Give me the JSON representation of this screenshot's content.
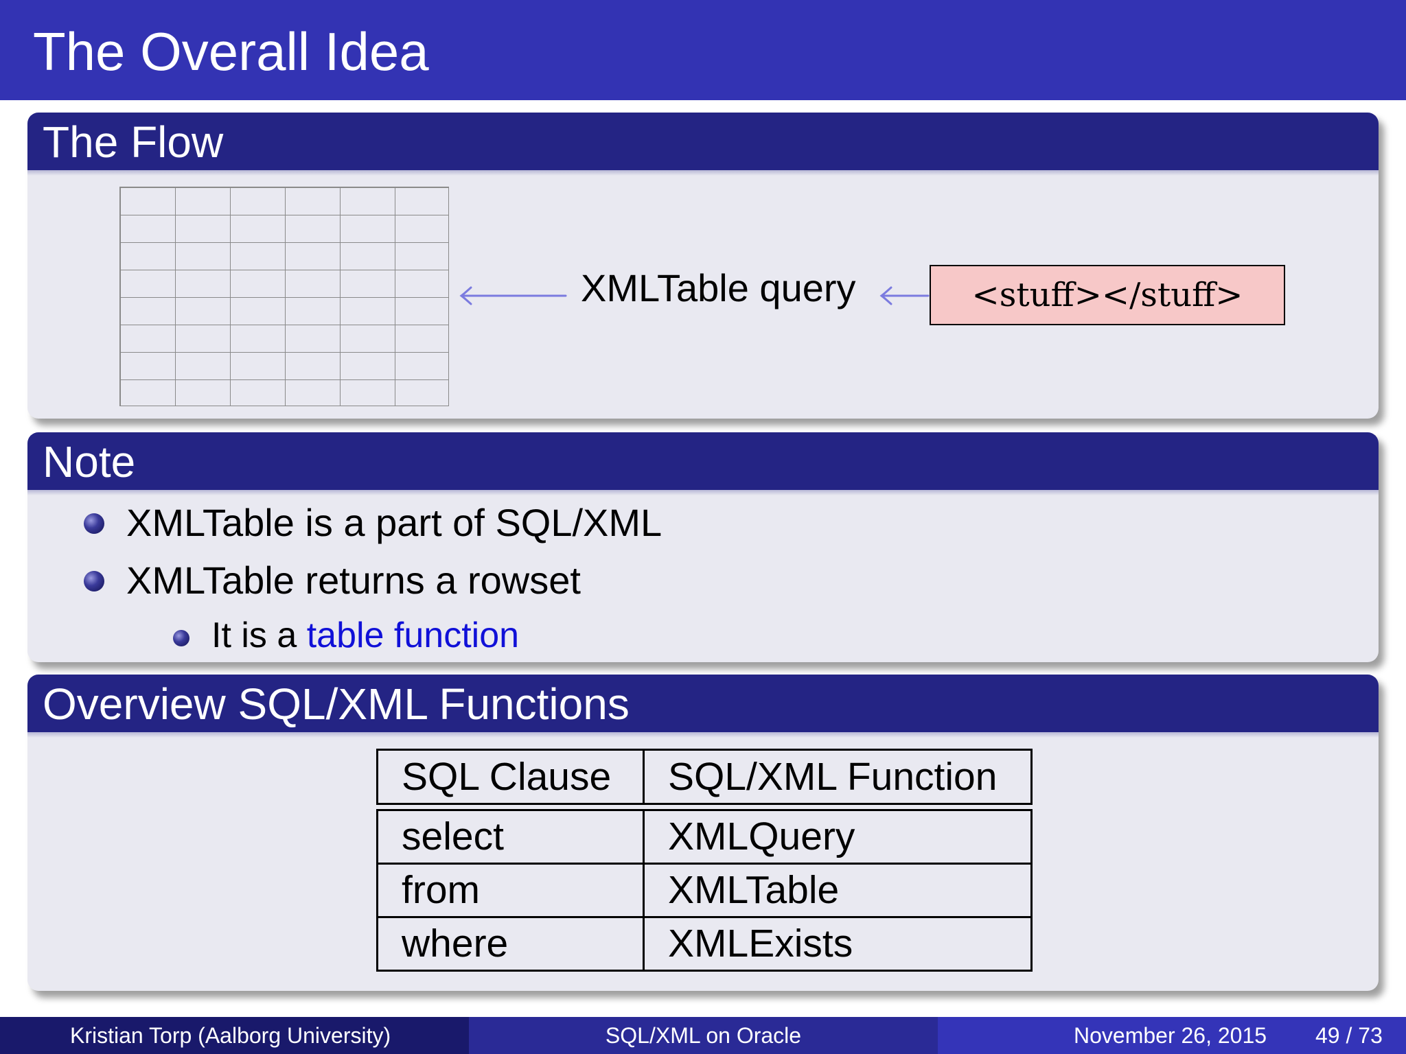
{
  "slide": {
    "title": "The Overall Idea"
  },
  "flow_block": {
    "heading": "The Flow",
    "query_label": "XMLTable query",
    "xml_box": "<stuff></stuff>"
  },
  "note_block": {
    "heading": "Note",
    "items": [
      "XMLTable is a part of SQL/XML",
      "XMLTable returns a rowset"
    ],
    "sub_item_prefix": "It is a ",
    "sub_item_link": "table function"
  },
  "overview_block": {
    "heading": "Overview SQL/XML Functions",
    "columns": [
      "SQL Clause",
      "SQL/XML Function"
    ],
    "rows": [
      [
        "select",
        "XMLQuery"
      ],
      [
        "from",
        "XMLTable"
      ],
      [
        "where",
        "XMLExists"
      ]
    ]
  },
  "footer": {
    "author": "Kristian Torp  (Aalborg University)",
    "presentation": "SQL/XML on Oracle",
    "date": "November 26, 2015",
    "page": "49 / 73"
  },
  "colors": {
    "title_bar": "#3333b3",
    "block_header": "#242484",
    "block_body": "#e9e9f1",
    "arrow": "#7b7bdf",
    "xml_box_fill": "#f7c8c8",
    "link": "#1010d8"
  }
}
